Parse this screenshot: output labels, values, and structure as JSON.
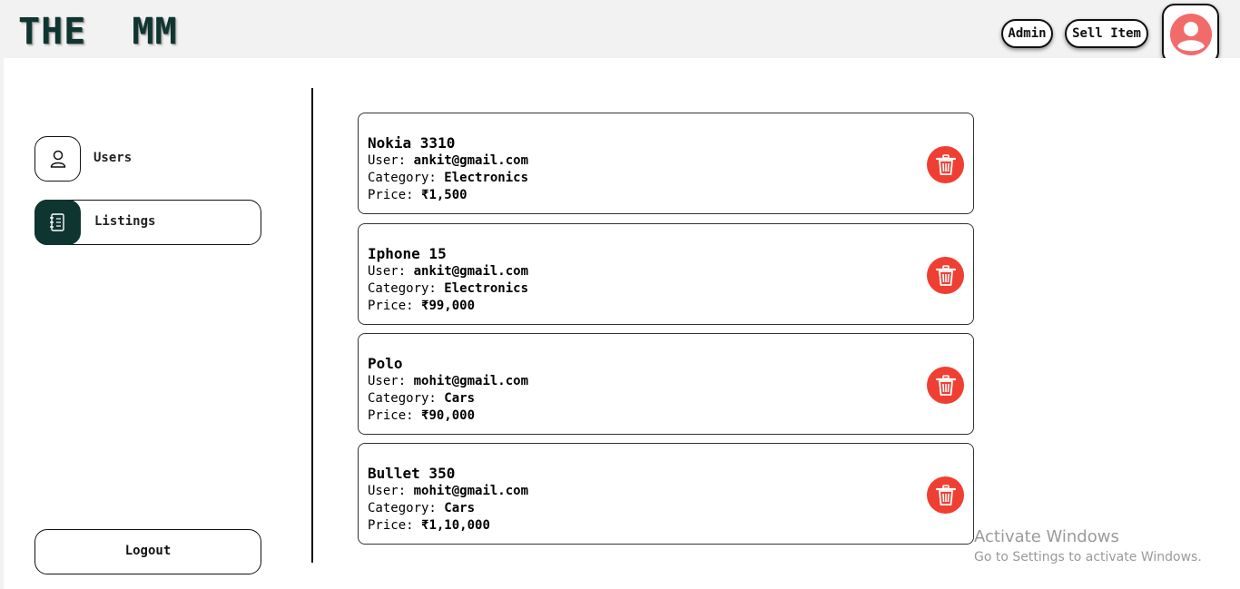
{
  "header": {
    "logo": "THE  MM",
    "admin_label": "Admin",
    "sell_label": "Sell Item",
    "profile_icon": "user-avatar-icon"
  },
  "sidebar": {
    "items": [
      {
        "label": "Users",
        "icon": "user-icon",
        "active": false
      },
      {
        "label": "Listings",
        "icon": "notebook-icon",
        "active": true
      }
    ],
    "logout_label": "Logout"
  },
  "listings": [
    {
      "name": "Nokia 3310",
      "user_label": "User:",
      "user": "ankit@gmail.com",
      "category_label": "Category:",
      "category": "Electronics",
      "price_label": "Price:",
      "price": "₹1,500"
    },
    {
      "name": "Iphone 15",
      "user_label": "User:",
      "user": "ankit@gmail.com",
      "category_label": "Category:",
      "category": "Electronics",
      "price_label": "Price:",
      "price": "₹99,000"
    },
    {
      "name": "Polo",
      "user_label": "User:",
      "user": "mohit@gmail.com",
      "category_label": "Category:",
      "category": "Cars",
      "price_label": "Price:",
      "price": "₹90,000"
    },
    {
      "name": "Bullet 350",
      "user_label": "User:",
      "user": "mohit@gmail.com",
      "category_label": "Category:",
      "category": "Cars",
      "price_label": "Price:",
      "price": "₹1,10,000"
    }
  ],
  "watermark": {
    "title": "Activate Windows",
    "subtitle": "Go to Settings to activate Windows."
  },
  "colors": {
    "brand_dark": "#0f3530",
    "delete_red": "#ef3f33",
    "avatar_pink": "#f26b6b"
  }
}
